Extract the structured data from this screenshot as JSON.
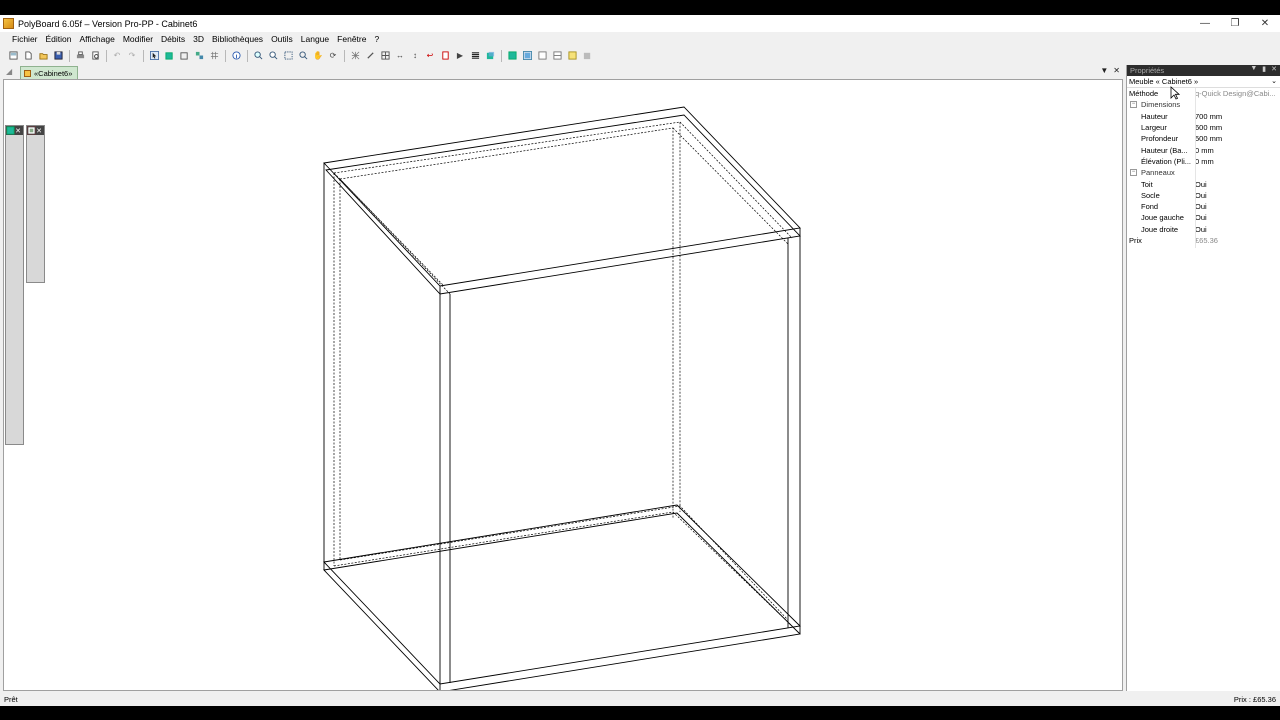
{
  "window": {
    "title": "PolyBoard 6.05f – Version Pro-PP - Cabinet6",
    "controls": [
      "minimize",
      "restore",
      "close"
    ]
  },
  "menu": [
    "Fichier",
    "Édition",
    "Affichage",
    "Modifier",
    "Débits",
    "3D",
    "Bibliothèques",
    "Outils",
    "Langue",
    "Fenêtre",
    "?"
  ],
  "document_tab": {
    "label": "«Cabinet6»"
  },
  "properties": {
    "title": "Propriétés",
    "selector": "Meuble « Cabinet6 »",
    "methode_label": "Méthode",
    "methode_value": "q-Quick Design@Cabi...",
    "dimensions_label": "Dimensions",
    "dimensions": [
      {
        "name": "Hauteur",
        "value": "700 mm"
      },
      {
        "name": "Largeur",
        "value": "600 mm"
      },
      {
        "name": "Profondeur",
        "value": "500 mm"
      },
      {
        "name": "Hauteur (Ba...",
        "value": "0 mm"
      },
      {
        "name": "Élévation (Pli...",
        "value": "0 mm"
      }
    ],
    "panneaux_label": "Panneaux",
    "panneaux": [
      {
        "name": "Toit",
        "value": "Oui"
      },
      {
        "name": "Socle",
        "value": "Oui"
      },
      {
        "name": "Fond",
        "value": "Oui"
      },
      {
        "name": "Joue gauche",
        "value": "Oui"
      },
      {
        "name": "Joue droite",
        "value": "Oui"
      }
    ],
    "prix_label": "Prix",
    "prix_value": "£65.36"
  },
  "status": {
    "left": "Prêt",
    "right": "Prix : £65.36"
  },
  "colors": {
    "accent_green": "#1fb89a",
    "tab_green": "#cfe7cf",
    "drawing_line": "#000000"
  }
}
